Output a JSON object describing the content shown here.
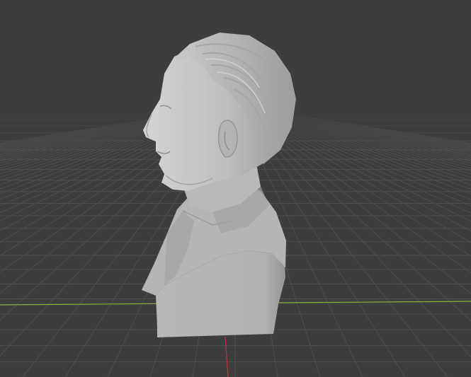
{
  "viewport": {
    "background": "#3d3d3d",
    "grid_color": "#4e4e4e",
    "x_axis_color": "#8cb43c",
    "y_axis_color": "#c8323c",
    "model": {
      "name": "sculpted-bust",
      "base_color": "#bdbdbd",
      "shadow_color": "#8f8f8f",
      "highlight_color": "#d2d2d2"
    }
  }
}
